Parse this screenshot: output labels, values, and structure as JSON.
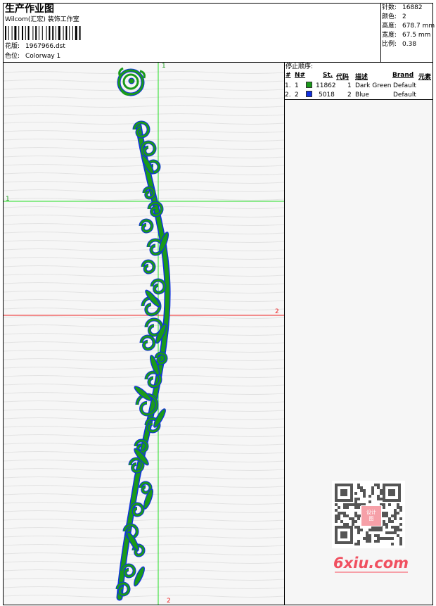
{
  "header": {
    "title": "生产作业图",
    "studio": "Wilcom(汇宏) 装饰工作室",
    "design_label": "花版:",
    "design_file": "1967966.dst",
    "colorway_label": "色位:",
    "colorway": "Colorway 1"
  },
  "stats": [
    {
      "label": "针数:",
      "value": "16882"
    },
    {
      "label": "颜色:",
      "value": "2"
    },
    {
      "label": "高度:",
      "value": "678.7 mm"
    },
    {
      "label": "宽度:",
      "value": "67.5 mm"
    },
    {
      "label": "比例:",
      "value": "0.38"
    }
  ],
  "stop_sequence": {
    "title": "停止顺序:",
    "columns": [
      "#",
      "N#",
      "St.",
      "代码",
      "描述",
      "Brand",
      "元素"
    ],
    "rows": [
      {
        "idx": "1.",
        "n": "1",
        "color": "#1a9a1a",
        "stitches": "11862",
        "code": "1",
        "desc": "Dark Green",
        "brand": "Default"
      },
      {
        "idx": "2.",
        "n": "2",
        "color": "#1030e0",
        "stitches": "5018",
        "code": "2",
        "desc": "Blue",
        "brand": "Default"
      }
    ]
  },
  "guides": {
    "vertical_top": "1",
    "vertical_bottom": "2",
    "horizontal_green": "1",
    "horizontal_red": "2"
  },
  "watermark": {
    "text": "6xiu.com",
    "qr_badge": "设计图"
  },
  "colors": {
    "green_thread": "#1a9a1a",
    "blue_thread": "#1030e0",
    "guide_green": "#22dd22",
    "guide_red": "#ee2222",
    "watermark": "#f05060"
  }
}
